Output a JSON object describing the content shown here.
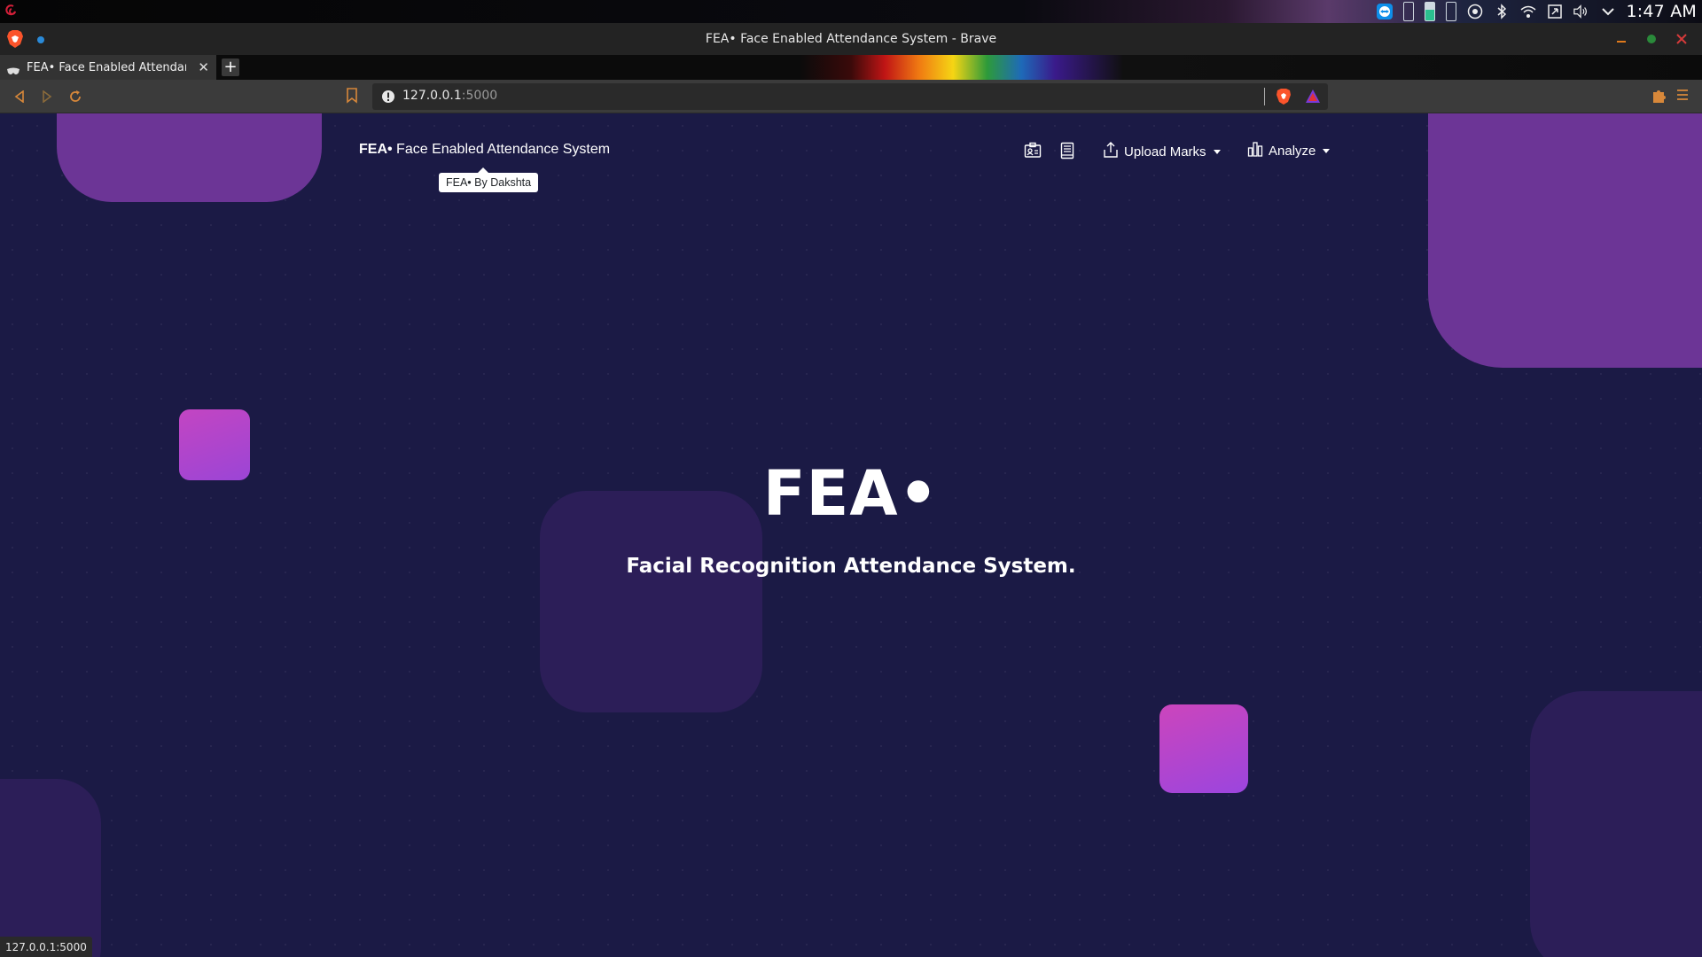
{
  "os_panel": {
    "clock": "1:47 AM",
    "tray_icons": [
      "teamviewer-icon",
      "phone-battery-icon",
      "phone-battery-icon",
      "phone-battery-icon",
      "keyboard-layout-icon",
      "bluetooth-icon",
      "wifi-icon",
      "screen-icon",
      "volume-icon",
      "chevron-down-icon"
    ]
  },
  "browser": {
    "window_title": "FEA• Face Enabled Attendance System - Brave",
    "tab": {
      "title": "FEA• Face Enabled Attendance System"
    },
    "url": {
      "host": "127.0.0.1",
      "port": ":5000"
    },
    "status_url": "127.0.0.1:5000"
  },
  "navbar": {
    "brand_strong": "FEA•",
    "brand_rest": " Face Enabled Attendance System",
    "tooltip": "FEA• By Dakshta",
    "upload_marks_label": "Upload Marks",
    "analyze_label": "Analyze"
  },
  "hero": {
    "title": "FEA•",
    "subtitle": "Facial Recognition Attendance System."
  },
  "colors": {
    "page_bg": "#1b1a45",
    "shape_purple": "#6c3596",
    "shape_dark": "#2c1e58",
    "shape_pink": "#c345c2"
  }
}
